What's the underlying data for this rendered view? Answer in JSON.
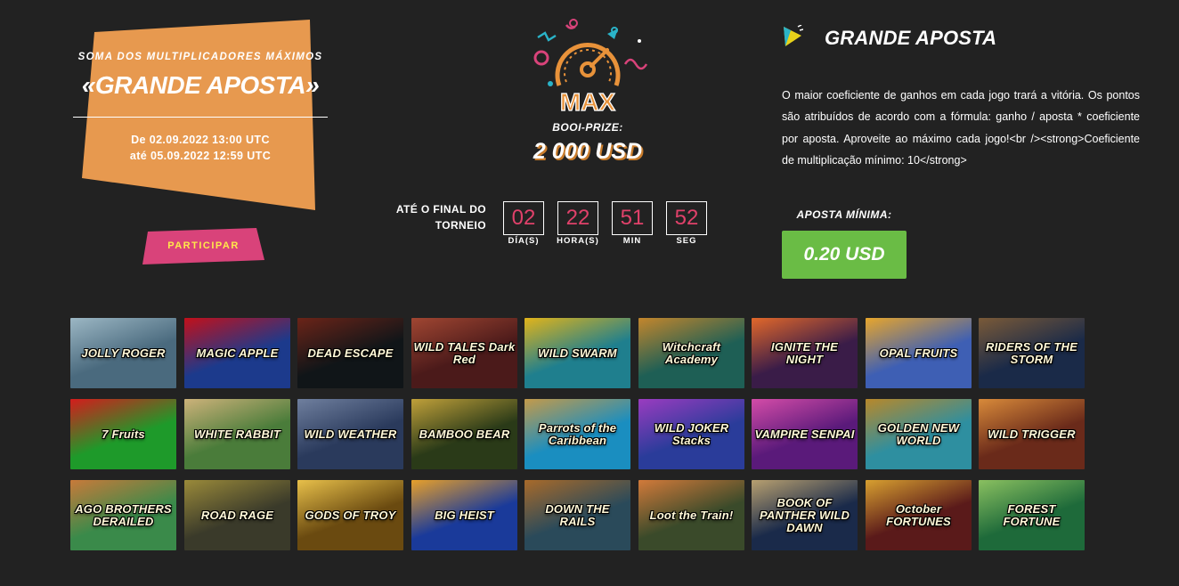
{
  "colors": {
    "background": "#222222",
    "promo_orange": "#e7994f",
    "participar_pink": "#d9437a",
    "participar_text": "#ffe94a",
    "countdown_digits": "#e0416a",
    "min_bet_green": "#6abc45",
    "gauge_orange": "#e8923a"
  },
  "promo": {
    "subtitle": "SOMA DOS MULTIPLICADORES MÁXIMOS",
    "title": "«GRANDE APOSTA»",
    "date_from": "De 02.09.2022 13:00 UTC",
    "date_to": "até 05.09.2022 12:59 UTC",
    "join_button": "PARTICIPAR"
  },
  "center": {
    "gauge_icon": "speedometer-max-icon",
    "gauge_text": "MAX",
    "prize_label": "BOOI-PRIZE:",
    "prize_value": "2 000 USD",
    "until_label_line1": "ATÉ O FINAL DO",
    "until_label_line2": "TORNEIO",
    "countdown": [
      {
        "value": "02",
        "unit": "DÍA(S)"
      },
      {
        "value": "22",
        "unit": "HORA(S)"
      },
      {
        "value": "51",
        "unit": "MIN"
      },
      {
        "value": "52",
        "unit": "SEG"
      }
    ]
  },
  "right": {
    "icon": "play-triangle-icon",
    "title": "GRANDE APOSTA",
    "description": "O maior coeficiente de ganhos em cada jogo trará a vitória. Os pontos são atribuídos de acordo com a fórmula: ganho / aposta * coeficiente por aposta. Aproveite ao máximo cada jogo!<br /><strong>Coeficiente de multiplicação mínimo: 10</strong>",
    "min_bet_label": "APOSTA MÍNIMA:",
    "min_bet_value": "0.20 USD"
  },
  "games": [
    {
      "name": "JOLLY ROGER",
      "bg": "#4a6a7e",
      "bg2": "#9cb7c4"
    },
    {
      "name": "MAGIC APPLE",
      "bg": "#1c3a8c",
      "bg2": "#c3101a"
    },
    {
      "name": "DEAD ESCAPE",
      "bg": "#101518",
      "bg2": "#6b2418"
    },
    {
      "name": "WILD TALES Dark Red",
      "bg": "#4b1a1a",
      "bg2": "#a04632"
    },
    {
      "name": "WILD SWARM",
      "bg": "#1f7f8e",
      "bg2": "#e2b41a"
    },
    {
      "name": "Witchcraft Academy",
      "bg": "#1e5f55",
      "bg2": "#c4862c"
    },
    {
      "name": "IGNITE THE NIGHT",
      "bg": "#3a1c48",
      "bg2": "#e2682a"
    },
    {
      "name": "OPAL FRUITS",
      "bg": "#3e5fb4",
      "bg2": "#e8a62c"
    },
    {
      "name": "RIDERS OF THE STORM",
      "bg": "#1a2a48",
      "bg2": "#7a5a38"
    },
    {
      "name": "7 Fruits",
      "bg": "#1e9a2a",
      "bg2": "#d41c1c"
    },
    {
      "name": "WHITE RABBIT",
      "bg": "#4a7c3a",
      "bg2": "#cdb27a"
    },
    {
      "name": "WILD WEATHER",
      "bg": "#2a3a5c",
      "bg2": "#6f7f9e"
    },
    {
      "name": "BAMBOO BEAR",
      "bg": "#2a3a18",
      "bg2": "#c0a03a"
    },
    {
      "name": "Parrots of the Caribbean",
      "bg": "#1a8ec0",
      "bg2": "#c49a4a"
    },
    {
      "name": "WILD JOKER Stacks",
      "bg": "#2a3c9a",
      "bg2": "#9a3cc0"
    },
    {
      "name": "VAMPIRE SENPAI",
      "bg": "#5a1a7a",
      "bg2": "#d44ca8"
    },
    {
      "name": "GOLDEN NEW WORLD",
      "bg": "#2e8fa0",
      "bg2": "#b8882a"
    },
    {
      "name": "WILD TRIGGER",
      "bg": "#6a2a1a",
      "bg2": "#d88a3a"
    },
    {
      "name": "AGO BROTHERS DERAILED",
      "bg": "#3a8a4a",
      "bg2": "#c87a3a"
    },
    {
      "name": "ROAD RAGE",
      "bg": "#3a3a2a",
      "bg2": "#9a8a3a"
    },
    {
      "name": "GODS OF TROY",
      "bg": "#6a4a10",
      "bg2": "#e8c04a"
    },
    {
      "name": "BIG HEIST",
      "bg": "#1a3a9a",
      "bg2": "#e8a02a"
    },
    {
      "name": "DOWN THE RAILS",
      "bg": "#2a4a5a",
      "bg2": "#a86a2a"
    },
    {
      "name": "Loot the Train!",
      "bg": "#3a4a2a",
      "bg2": "#d27a3a"
    },
    {
      "name": "BOOK OF PANTHER WILD DAWN",
      "bg": "#1a2a4a",
      "bg2": "#b8a070"
    },
    {
      "name": "October FORTUNES",
      "bg": "#5a1a1a",
      "bg2": "#d8a030"
    },
    {
      "name": "FOREST FORTUNE",
      "bg": "#1e6a3a",
      "bg2": "#8ac060"
    }
  ]
}
